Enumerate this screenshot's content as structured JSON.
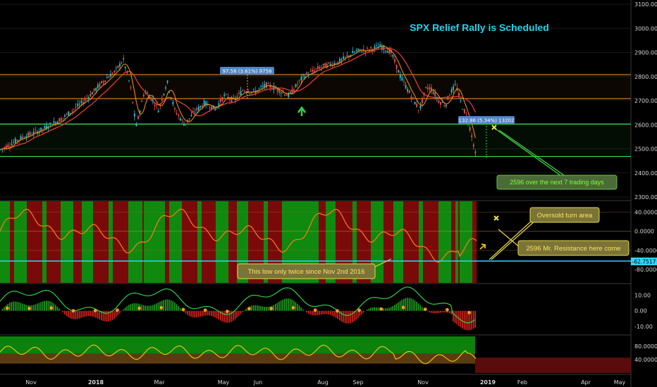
{
  "chart_data": {
    "type": "line",
    "title": "SPX Relief Rally is Scheduled",
    "x_tick_labels": [
      "Nov",
      "2018",
      "Mar",
      "May",
      "Jun",
      "Aug",
      "Sep",
      "Nov",
      "2019",
      "Feb",
      "Apr",
      "May"
    ],
    "main_panel": {
      "y_ticks": [
        "3100.00",
        "3000.00",
        "2900.00",
        "2800.00",
        "2700.00",
        "2600.00",
        "2500.00",
        "2400.00",
        "2300.00"
      ],
      "ylim": [
        2300,
        3100
      ],
      "price_keyframes": [
        [
          0,
          2495
        ],
        [
          30,
          2545
        ],
        [
          60,
          2580
        ],
        [
          90,
          2630
        ],
        [
          120,
          2700
        ],
        [
          150,
          2790
        ],
        [
          163,
          2820
        ],
        [
          175,
          2870
        ],
        [
          185,
          2760
        ],
        [
          193,
          2590
        ],
        [
          205,
          2740
        ],
        [
          215,
          2710
        ],
        [
          225,
          2660
        ],
        [
          237,
          2780
        ],
        [
          248,
          2660
        ],
        [
          262,
          2600
        ],
        [
          275,
          2650
        ],
        [
          290,
          2690
        ],
        [
          305,
          2665
        ],
        [
          318,
          2720
        ],
        [
          332,
          2700
        ],
        [
          345,
          2745
        ],
        [
          360,
          2735
        ],
        [
          378,
          2765
        ],
        [
          395,
          2745
        ],
        [
          410,
          2720
        ],
        [
          430,
          2800
        ],
        [
          455,
          2840
        ],
        [
          480,
          2860
        ],
        [
          505,
          2905
        ],
        [
          520,
          2910
        ],
        [
          540,
          2925
        ],
        [
          555,
          2900
        ],
        [
          568,
          2800
        ],
        [
          585,
          2710
        ],
        [
          595,
          2660
        ],
        [
          605,
          2755
        ],
        [
          612,
          2750
        ],
        [
          622,
          2700
        ],
        [
          632,
          2680
        ],
        [
          638,
          2730
        ],
        [
          647,
          2765
        ],
        [
          655,
          2680
        ],
        [
          663,
          2630
        ],
        [
          670,
          2545
        ],
        [
          676,
          2455
        ]
      ],
      "zones": [
        {
          "from": 2708,
          "to": 2808,
          "color": "#d17a1b"
        },
        {
          "from": 2468,
          "to": 2603,
          "color": "#2ee04c"
        }
      ],
      "measure_label_1": "97.58 (3.61%) 9758",
      "measure_label_2": "132.86 (5.34%) 13202",
      "target_annotation": "2596 over the next 7 trading days"
    },
    "oscillator_panel": {
      "y_ticks": [
        "40.0000",
        "0.0000",
        "-40.0000",
        "-80.0000"
      ],
      "current_value": "-62.7517",
      "ylim": [
        -105,
        60
      ],
      "annotation_low": "This low only twice since Nov 2nd 2016",
      "annotation_turn": "Oversold turn area",
      "annotation_resistance": "2596 Mr. Resistance here come"
    },
    "histogram_panel": {
      "y_ticks": [
        "10.00",
        "0.00",
        "-10.00"
      ],
      "ylim": [
        -14,
        16
      ]
    },
    "rsi_panel": {
      "y_ticks": [
        "80.0000",
        "40.0000"
      ],
      "ylim": [
        0,
        110
      ]
    }
  },
  "colors": {
    "background": "#000000",
    "candle_up": "#26c6da",
    "candle_down": "#ef5350",
    "ma_fast": "#ff9800",
    "ma_slow": "#e53935",
    "zone_orange": "#d17a1b",
    "zone_green": "#2ee04c",
    "title": "#22d3ee",
    "cyan_line": "#2ed6ff",
    "annotation_fill": "#7a7436",
    "annotation_border": "#e6d84a",
    "annotation_text": "#ffe066",
    "target_fill": "#4a6b38",
    "target_text": "#7dff3a",
    "measure_fill": "#4f86c6",
    "rsi_line": "#f5c518"
  }
}
